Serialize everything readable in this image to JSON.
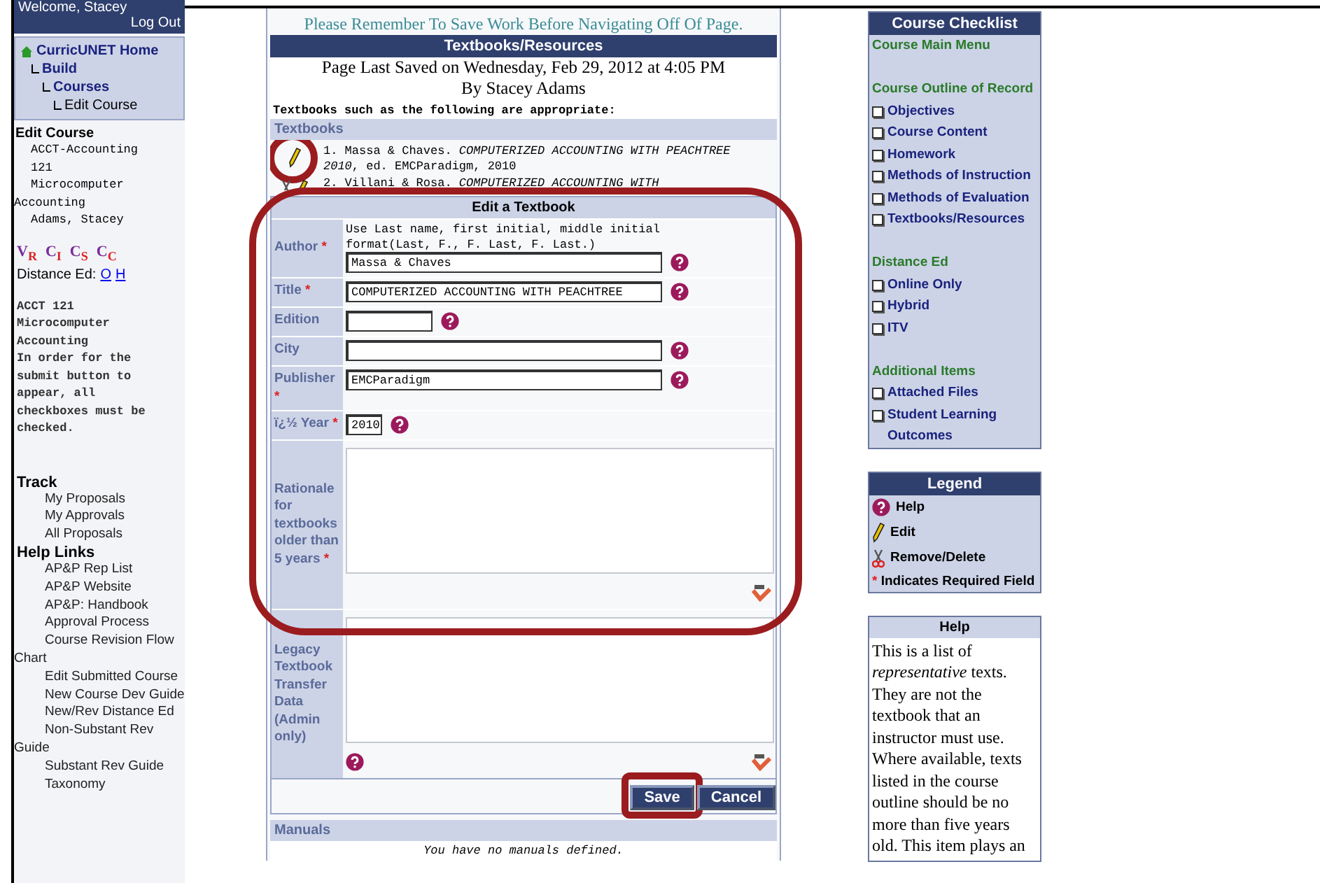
{
  "sidebar": {
    "welcome": "Welcome, Stacey",
    "logout": "Log Out",
    "breadcrumb": [
      {
        "label": "CurricUNET Home",
        "children": [
          {
            "label": "Build",
            "children": [
              {
                "label": "Courses",
                "children": [
                  {
                    "label": "Edit Course"
                  }
                ]
              }
            ]
          }
        ]
      }
    ],
    "course_heading": "Edit Course",
    "course_lines": [
      {
        "text": "ACCT-Accounting",
        "kind": "indented"
      },
      {
        "text": "121",
        "kind": "indented"
      },
      {
        "text": "Microcomputer",
        "kind": "indented"
      },
      {
        "text": "Accounting",
        "kind": "flush"
      },
      {
        "text": "Adams, Stacey",
        "kind": "indented"
      }
    ],
    "badges": [
      {
        "a": "V",
        "b": "R"
      },
      {
        "a": "C",
        "b": "I"
      },
      {
        "a": "C",
        "b": "S"
      },
      {
        "a": "C",
        "b": "C"
      }
    ],
    "distance_label": "Distance Ed:",
    "distance_links": [
      "O",
      "H"
    ],
    "notice_lines": [
      "ACCT 121",
      "Microcomputer",
      "Accounting",
      "In order for the",
      "submit button to",
      "appear, all",
      "checkboxes must be",
      "checked."
    ],
    "sections": [
      {
        "heading": "Track",
        "links": [
          "My Proposals",
          "My Approvals",
          "All Proposals"
        ]
      },
      {
        "heading": "Help Links",
        "links": [
          "AP&P Rep List",
          "AP&P Website",
          "AP&P: Handbook",
          "Approval Process",
          "Course Revision Flow Chart",
          "Edit Submitted Course",
          "New Course Dev Guide",
          "New/Rev Distance Ed",
          "Non-Substant Rev Guide",
          "Substant Rev Guide",
          "Taxonomy"
        ]
      }
    ]
  },
  "main": {
    "reminder": "Please Remember To Save Work Before Navigating Off Of Page.",
    "title": "Textbooks/Resources",
    "saved": "Page Last Saved on Wednesday, Feb 29, 2012 at 4:05 PM",
    "saved_by": "By Stacey Adams",
    "intro": "Textbooks such as the following are appropriate:",
    "textbooks_heading": "Textbooks",
    "textbooks": [
      {
        "text": "1. Massa & Chaves. *COMPUTERIZED ACCOUNTING WITH PEACHTREE 2010*, ed. EMCParadigm, 2010",
        "removable": false
      },
      {
        "text": "2. Villani & Rosa. *COMPUTERIZED ACCOUNTING WITH*",
        "removable": true
      }
    ],
    "edit": {
      "title": "Edit a Textbook",
      "fields": [
        {
          "label": "Author",
          "required_mark": "*",
          "kind": "longfield",
          "hint": "Use Last name, first initial, middle initial format(Last, F., F. Last, F. Last.)",
          "value": "Massa & Chaves",
          "help": true
        },
        {
          "label": "Title",
          "required_mark": "*",
          "kind": "longfield",
          "value": "COMPUTERIZED ACCOUNTING WITH PEACHTREE",
          "help": true
        },
        {
          "label": "Edition",
          "kind": "shortfield",
          "help": true
        },
        {
          "label": "City",
          "kind": "longfield",
          "help": true
        },
        {
          "label": "Publisher",
          "required_mark": "*",
          "kind": "longfield",
          "value": "EMCParadigm",
          "help": true
        },
        {
          "label": "ï¿½ Year",
          "required_mark": "*",
          "kind": "tinyfield",
          "value": "2010",
          "help": true
        },
        {
          "label": "Rationale for textbooks older than 5 years",
          "required_mark": "*",
          "kind": "textarea",
          "help": false
        },
        {
          "label": "Legacy Textbook Transfer Data (Admin only)",
          "kind": "textarea",
          "help": true
        }
      ],
      "buttons": [
        "Save",
        "Cancel"
      ]
    },
    "manuals_heading": "Manuals",
    "manuals_empty": "You have no manuals defined."
  },
  "checklist": {
    "title": "Course Checklist",
    "items": [
      {
        "kind": "link",
        "text": "Course Main Menu"
      },
      {
        "kind": "gap"
      },
      {
        "kind": "heading",
        "text": "Course Outline of Record"
      },
      {
        "kind": "check",
        "text": "Objectives",
        "checked": false
      },
      {
        "kind": "check",
        "text": "Course Content",
        "checked": false
      },
      {
        "kind": "check",
        "text": "Homework",
        "checked": false
      },
      {
        "kind": "check",
        "text": "Methods of Instruction",
        "checked": false
      },
      {
        "kind": "check",
        "text": "Methods of Evaluation",
        "checked": false
      },
      {
        "kind": "check",
        "text": "Textbooks/Resources",
        "checked": false
      },
      {
        "kind": "gap"
      },
      {
        "kind": "heading",
        "text": "Distance Ed"
      },
      {
        "kind": "check",
        "text": "Online Only",
        "checked": false
      },
      {
        "kind": "check",
        "text": "Hybrid",
        "checked": false
      },
      {
        "kind": "check",
        "text": "ITV",
        "checked": false
      },
      {
        "kind": "gap"
      },
      {
        "kind": "heading",
        "text": "Additional Items"
      },
      {
        "kind": "check",
        "text": "Attached Files",
        "checked": false
      },
      {
        "kind": "check",
        "text": "Student Learning Outcomes",
        "checked": false
      }
    ]
  },
  "legend": {
    "title": "Legend",
    "items": [
      {
        "kind": "help",
        "text": "Help"
      },
      {
        "kind": "edit",
        "text": "Edit"
      },
      {
        "kind": "remove",
        "text": "Remove/Delete"
      },
      {
        "kind": "required",
        "mark": "*",
        "text": "Indicates Required Field"
      }
    ]
  },
  "help": {
    "title": "Help",
    "text": "This is a list of *representative* texts. They are not the textbook that an instructor must use. Where available, texts listed in the course outline should be no more than five years old. This item plays an"
  }
}
